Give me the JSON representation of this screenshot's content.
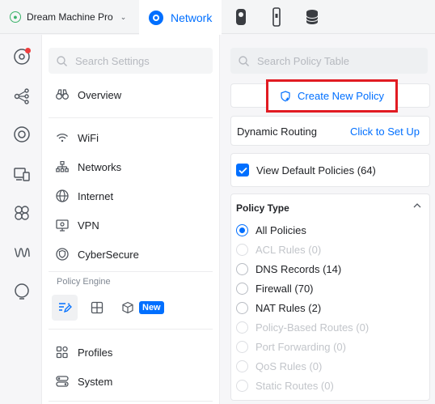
{
  "topbar": {
    "console_name": "Dream Machine Pro",
    "active_app": "Network"
  },
  "nav": {
    "search_placeholder": "Search Settings",
    "items": [
      {
        "label": "Overview"
      },
      {
        "label": "WiFi"
      },
      {
        "label": "Networks"
      },
      {
        "label": "Internet"
      },
      {
        "label": "VPN"
      },
      {
        "label": "CyberSecure"
      },
      {
        "label": "Profiles"
      },
      {
        "label": "System"
      }
    ],
    "policy_engine_label": "Policy Engine",
    "new_badge": "New"
  },
  "panel": {
    "search_placeholder": "Search Policy Table",
    "create_label": "Create New Policy",
    "dynamic_routing_label": "Dynamic Routing",
    "dynamic_routing_link": "Click to Set Up",
    "view_default_label": "View Default Policies (64)",
    "policy_type_title": "Policy Type",
    "policy_types": [
      {
        "label": "All Policies"
      },
      {
        "label": "ACL Rules (0)"
      },
      {
        "label": "DNS Records (14)"
      },
      {
        "label": "Firewall (70)"
      },
      {
        "label": "NAT Rules (2)"
      },
      {
        "label": "Policy-Based Routes (0)"
      },
      {
        "label": "Port Forwarding (0)"
      },
      {
        "label": "QoS Rules (0)"
      },
      {
        "label": "Static Routes (0)"
      }
    ]
  },
  "colors": {
    "accent": "#006fff",
    "highlight_box": "#e11b22",
    "notification": "#ef3e3e"
  }
}
